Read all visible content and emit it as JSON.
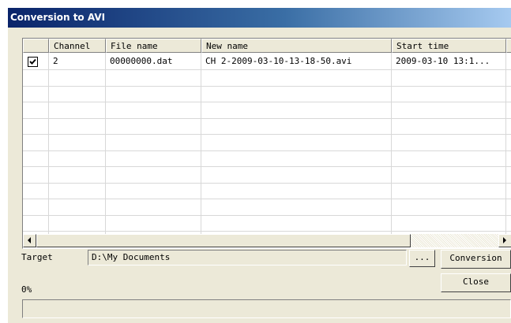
{
  "window": {
    "title": "Conversion to AVI"
  },
  "table": {
    "columns": [
      "",
      "Channel",
      "File name",
      "New name",
      "Start time"
    ],
    "rows": [
      {
        "checked": true,
        "channel": "2",
        "file_name": "00000000.dat",
        "new_name": "CH 2-2009-03-10-13-18-50.avi",
        "start_time": "2009-03-10 13:1..."
      }
    ]
  },
  "target": {
    "label": "Target",
    "value": "D:\\My Documents",
    "browse_label": "..."
  },
  "buttons": {
    "conversion": "Conversion",
    "close": "Close"
  },
  "progress": {
    "label": "0%",
    "value": 0
  }
}
